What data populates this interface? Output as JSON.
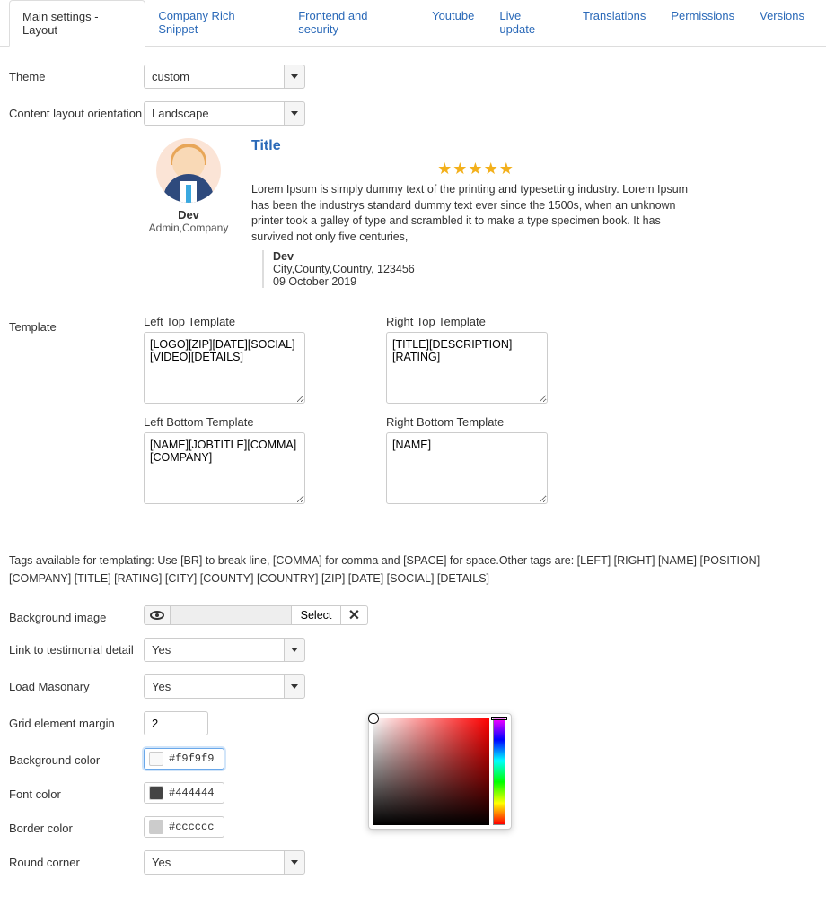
{
  "tabs": [
    {
      "label": "Main settings - Layout",
      "active": true
    },
    {
      "label": "Company Rich Snippet"
    },
    {
      "label": "Frontend and security"
    },
    {
      "label": "Youtube"
    },
    {
      "label": "Live update"
    },
    {
      "label": "Translations"
    },
    {
      "label": "Permissions"
    },
    {
      "label": "Versions"
    }
  ],
  "theme": {
    "label": "Theme",
    "value": "custom"
  },
  "orientation": {
    "label": "Content layout orientation",
    "value": "Landscape"
  },
  "preview": {
    "name": "Dev",
    "role": "Admin,Company",
    "title": "Title",
    "text": "Lorem Ipsum is simply dummy text of the printing and typesetting industry. Lorem Ipsum has been the industrys standard dummy text ever since the 1500s, when an unknown printer took a galley of type and scrambled it to make a type specimen book. It has survived not only five centuries,",
    "meta_name": "Dev",
    "meta_loc": "City,County,Country, 123456",
    "meta_date": "09 October 2019"
  },
  "template": {
    "section_label": "Template",
    "lt_label": "Left Top Template",
    "lt_value": "[LOGO][ZIP][DATE][SOCIAL][VIDEO][DETAILS]",
    "rt_label": "Right Top Template",
    "rt_value": "[TITLE][DESCRIPTION][RATING]",
    "lb_label": "Left Bottom Template",
    "lb_value": "[NAME][JOBTITLE][COMMA][COMPANY]",
    "rb_label": "Right Bottom Template",
    "rb_value": "[NAME]"
  },
  "tags_info": "Tags available for templating: Use [BR] to break line, [COMMA] for comma and [SPACE] for space.Other tags are: [LEFT] [RIGHT] [NAME] [POSITION] [COMPANY] [TITLE] [RATING] [CITY] [COUNTY] [COUNTRY] [ZIP] [DATE] [SOCIAL] [DETAILS]",
  "bg_image": {
    "label": "Background image",
    "select": "Select"
  },
  "link_detail": {
    "label": "Link to testimonial detail",
    "value": "Yes"
  },
  "masonary": {
    "label": "Load Masonary",
    "value": "Yes"
  },
  "grid_margin": {
    "label": "Grid element margin",
    "value": "2"
  },
  "bg_color": {
    "label": "Background color",
    "value": "#f9f9f9",
    "swatch": "#f9f9f9"
  },
  "font_color": {
    "label": "Font color",
    "value": "#444444",
    "swatch": "#444444"
  },
  "border_color": {
    "label": "Border color",
    "value": "#cccccc",
    "swatch": "#cccccc"
  },
  "round_corner": {
    "label": "Round corner",
    "value": "Yes"
  }
}
